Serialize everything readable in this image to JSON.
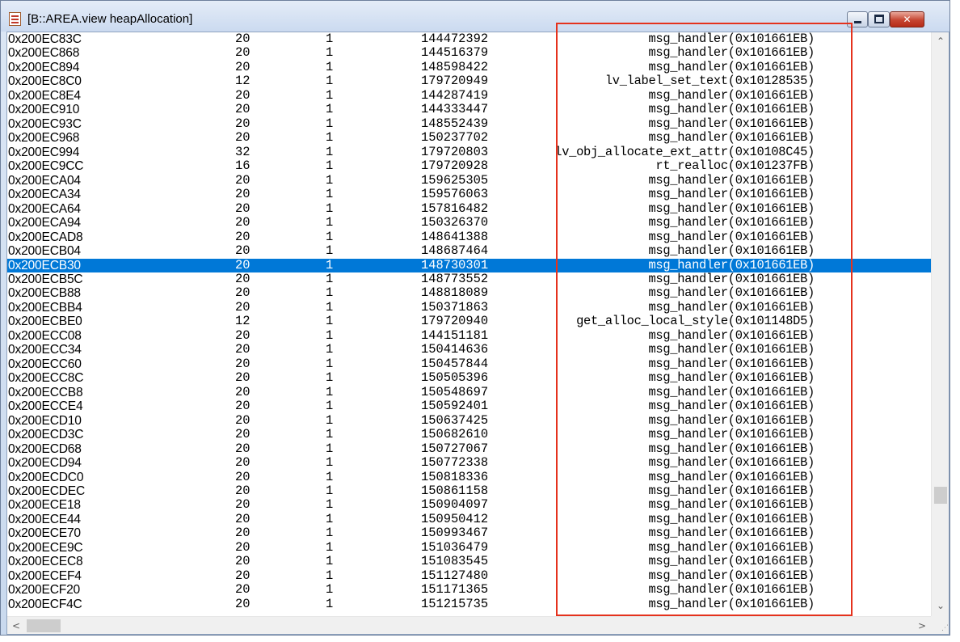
{
  "window": {
    "title": "[B::AREA.view heapAllocation]",
    "icon": "document-icon",
    "minimize_label": "minimize",
    "maximize_label": "maximize",
    "close_label": "✕"
  },
  "colors": {
    "selection": "#0078d7",
    "highlight_box": "#e5321d",
    "close_button": "#c64531"
  },
  "scrollbar": {
    "up": "⌃",
    "down": "⌄",
    "left": "<",
    "right": ">"
  },
  "selected_row_index": 16,
  "rows": [
    {
      "addr": "0x200EC83C",
      "size": "20",
      "count": "1",
      "time": "144472392",
      "caller": "msg_handler(0x101661EB)"
    },
    {
      "addr": "0x200EC868",
      "size": "20",
      "count": "1",
      "time": "144516379",
      "caller": "msg_handler(0x101661EB)"
    },
    {
      "addr": "0x200EC894",
      "size": "20",
      "count": "1",
      "time": "148598422",
      "caller": "msg_handler(0x101661EB)"
    },
    {
      "addr": "0x200EC8C0",
      "size": "12",
      "count": "1",
      "time": "179720949",
      "caller": "lv_label_set_text(0x10128535)"
    },
    {
      "addr": "0x200EC8E4",
      "size": "20",
      "count": "1",
      "time": "144287419",
      "caller": "msg_handler(0x101661EB)"
    },
    {
      "addr": "0x200EC910",
      "size": "20",
      "count": "1",
      "time": "144333447",
      "caller": "msg_handler(0x101661EB)"
    },
    {
      "addr": "0x200EC93C",
      "size": "20",
      "count": "1",
      "time": "148552439",
      "caller": "msg_handler(0x101661EB)"
    },
    {
      "addr": "0x200EC968",
      "size": "20",
      "count": "1",
      "time": "150237702",
      "caller": "msg_handler(0x101661EB)"
    },
    {
      "addr": "0x200EC994",
      "size": "32",
      "count": "1",
      "time": "179720803",
      "caller": "lv_obj_allocate_ext_attr(0x10108C45)"
    },
    {
      "addr": "0x200EC9CC",
      "size": "16",
      "count": "1",
      "time": "179720928",
      "caller": "rt_realloc(0x101237FB)"
    },
    {
      "addr": "0x200ECA04",
      "size": "20",
      "count": "1",
      "time": "159625305",
      "caller": "msg_handler(0x101661EB)"
    },
    {
      "addr": "0x200ECA34",
      "size": "20",
      "count": "1",
      "time": "159576063",
      "caller": "msg_handler(0x101661EB)"
    },
    {
      "addr": "0x200ECA64",
      "size": "20",
      "count": "1",
      "time": "157816482",
      "caller": "msg_handler(0x101661EB)"
    },
    {
      "addr": "0x200ECA94",
      "size": "20",
      "count": "1",
      "time": "150326370",
      "caller": "msg_handler(0x101661EB)"
    },
    {
      "addr": "0x200ECAD8",
      "size": "20",
      "count": "1",
      "time": "148641388",
      "caller": "msg_handler(0x101661EB)"
    },
    {
      "addr": "0x200ECB04",
      "size": "20",
      "count": "1",
      "time": "148687464",
      "caller": "msg_handler(0x101661EB)"
    },
    {
      "addr": "0x200ECB30",
      "size": "20",
      "count": "1",
      "time": "148730301",
      "caller": "msg_handler(0x101661EB)"
    },
    {
      "addr": "0x200ECB5C",
      "size": "20",
      "count": "1",
      "time": "148773552",
      "caller": "msg_handler(0x101661EB)"
    },
    {
      "addr": "0x200ECB88",
      "size": "20",
      "count": "1",
      "time": "148818089",
      "caller": "msg_handler(0x101661EB)"
    },
    {
      "addr": "0x200ECBB4",
      "size": "20",
      "count": "1",
      "time": "150371863",
      "caller": "msg_handler(0x101661EB)"
    },
    {
      "addr": "0x200ECBE0",
      "size": "12",
      "count": "1",
      "time": "179720940",
      "caller": "get_alloc_local_style(0x101148D5)"
    },
    {
      "addr": "0x200ECC08",
      "size": "20",
      "count": "1",
      "time": "144151181",
      "caller": "msg_handler(0x101661EB)"
    },
    {
      "addr": "0x200ECC34",
      "size": "20",
      "count": "1",
      "time": "150414636",
      "caller": "msg_handler(0x101661EB)"
    },
    {
      "addr": "0x200ECC60",
      "size": "20",
      "count": "1",
      "time": "150457844",
      "caller": "msg_handler(0x101661EB)"
    },
    {
      "addr": "0x200ECC8C",
      "size": "20",
      "count": "1",
      "time": "150505396",
      "caller": "msg_handler(0x101661EB)"
    },
    {
      "addr": "0x200ECCB8",
      "size": "20",
      "count": "1",
      "time": "150548697",
      "caller": "msg_handler(0x101661EB)"
    },
    {
      "addr": "0x200ECCE4",
      "size": "20",
      "count": "1",
      "time": "150592401",
      "caller": "msg_handler(0x101661EB)"
    },
    {
      "addr": "0x200ECD10",
      "size": "20",
      "count": "1",
      "time": "150637425",
      "caller": "msg_handler(0x101661EB)"
    },
    {
      "addr": "0x200ECD3C",
      "size": "20",
      "count": "1",
      "time": "150682610",
      "caller": "msg_handler(0x101661EB)"
    },
    {
      "addr": "0x200ECD68",
      "size": "20",
      "count": "1",
      "time": "150727067",
      "caller": "msg_handler(0x101661EB)"
    },
    {
      "addr": "0x200ECD94",
      "size": "20",
      "count": "1",
      "time": "150772338",
      "caller": "msg_handler(0x101661EB)"
    },
    {
      "addr": "0x200ECDC0",
      "size": "20",
      "count": "1",
      "time": "150818336",
      "caller": "msg_handler(0x101661EB)"
    },
    {
      "addr": "0x200ECDEC",
      "size": "20",
      "count": "1",
      "time": "150861158",
      "caller": "msg_handler(0x101661EB)"
    },
    {
      "addr": "0x200ECE18",
      "size": "20",
      "count": "1",
      "time": "150904097",
      "caller": "msg_handler(0x101661EB)"
    },
    {
      "addr": "0x200ECE44",
      "size": "20",
      "count": "1",
      "time": "150950412",
      "caller": "msg_handler(0x101661EB)"
    },
    {
      "addr": "0x200ECE70",
      "size": "20",
      "count": "1",
      "time": "150993467",
      "caller": "msg_handler(0x101661EB)"
    },
    {
      "addr": "0x200ECE9C",
      "size": "20",
      "count": "1",
      "time": "151036479",
      "caller": "msg_handler(0x101661EB)"
    },
    {
      "addr": "0x200ECEC8",
      "size": "20",
      "count": "1",
      "time": "151083545",
      "caller": "msg_handler(0x101661EB)"
    },
    {
      "addr": "0x200ECEF4",
      "size": "20",
      "count": "1",
      "time": "151127480",
      "caller": "msg_handler(0x101661EB)"
    },
    {
      "addr": "0x200ECF20",
      "size": "20",
      "count": "1",
      "time": "151171365",
      "caller": "msg_handler(0x101661EB)"
    },
    {
      "addr": "0x200ECF4C",
      "size": "20",
      "count": "1",
      "time": "151215735",
      "caller": "msg_handler(0x101661EB)"
    }
  ]
}
